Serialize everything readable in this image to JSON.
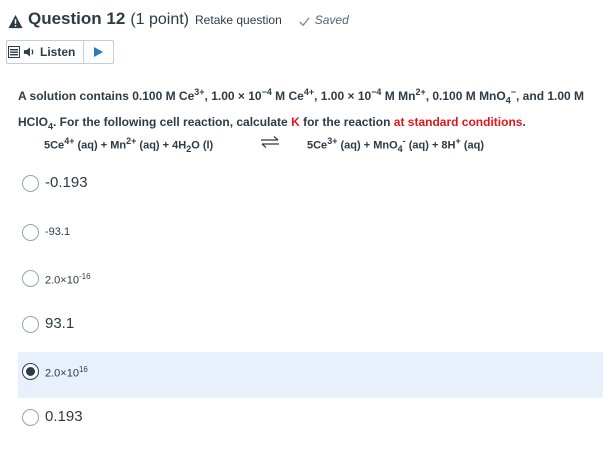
{
  "header": {
    "title": "Question 12",
    "points": "(1 point)",
    "retake": "Retake question",
    "saved": "Saved"
  },
  "listen": {
    "label": "Listen"
  },
  "question": {
    "p1": "A solution contains 0.100 M Ce",
    "p1_sup": "3+",
    "p2": ", 1.00 × 10",
    "p2_sup": "−4",
    "p3": " M Ce",
    "p3_sup": "4+",
    "p4": ", 1.00 × 10",
    "p4_sup": "−4",
    "p5": " M Mn",
    "p5_sup": "2+",
    "p6": ", 0.100 M MnO",
    "p6_sub": "4",
    "p6_sup": "−",
    "p7": ", and 1.00 M HClO",
    "p7_sub": "4",
    "p8": ". For the following cell reaction, calculate ",
    "k": "K",
    "p9": " for the reaction ",
    "std": "at standard conditions",
    "p10": "."
  },
  "reaction": {
    "l1": "5Ce",
    "l1_sup": "4+",
    "l2": " (aq) + Mn",
    "l2_sup": "2+",
    "l3": " (aq) + 4H",
    "l3_sub": "2",
    "l4": "O (l)",
    "r1": "5Ce",
    "r1_sup": "3+",
    "r2": " (aq) + MnO",
    "r2_sub": "4",
    "r2_sup": "-",
    "r3": " (aq) + 8H",
    "r3_sup": "+",
    "r4": " (aq)"
  },
  "choices": [
    {
      "text": "-0.193",
      "selected": false
    },
    {
      "text": "-93.1",
      "selected": false
    },
    {
      "base": "2.0×10",
      "exp": "-16",
      "selected": false
    },
    {
      "text": "93.1",
      "selected": false
    },
    {
      "base": "2.0×10",
      "exp": "16",
      "selected": true
    },
    {
      "text": "0.193",
      "selected": false
    }
  ],
  "icons": [
    "warning-icon",
    "check-icon",
    "menu-icon",
    "speaker-icon",
    "play-icon",
    "equilibrium-arrow-icon"
  ],
  "colors": {
    "text": "#2d3b45",
    "highlight": "#e0161b",
    "selected_bg": "#e8f0fb",
    "play": "#2a7abf"
  }
}
